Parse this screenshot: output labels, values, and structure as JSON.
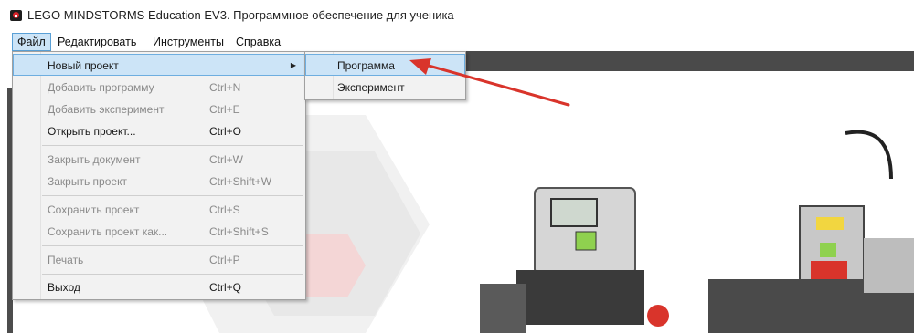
{
  "window": {
    "title": "LEGO MINDSTORMS Education EV3. Программное обеспечение для ученика"
  },
  "menubar": {
    "items": [
      {
        "label": "Файл"
      },
      {
        "label": "Редактировать"
      },
      {
        "label": "Инструменты"
      },
      {
        "label": "Справка"
      }
    ]
  },
  "file_menu": {
    "items": [
      {
        "label": "Новый проект",
        "shortcut": "",
        "submenu": true
      },
      {
        "label": "Добавить программу",
        "shortcut": "Ctrl+N",
        "disabled": true
      },
      {
        "label": "Добавить эксперимент",
        "shortcut": "Ctrl+E",
        "disabled": true
      },
      {
        "label": "Открыть проект...",
        "shortcut": "Ctrl+O"
      },
      {
        "label": "Закрыть документ",
        "shortcut": "Ctrl+W",
        "disabled": true
      },
      {
        "label": "Закрыть проект",
        "shortcut": "Ctrl+Shift+W",
        "disabled": true
      },
      {
        "label": "Сохранить проект",
        "shortcut": "Ctrl+S",
        "disabled": true
      },
      {
        "label": "Сохранить проект как...",
        "shortcut": "Ctrl+Shift+S",
        "disabled": true
      },
      {
        "label": "Печать",
        "shortcut": "Ctrl+P",
        "disabled": true
      },
      {
        "label": "Выход",
        "shortcut": "Ctrl+Q"
      }
    ]
  },
  "new_project_submenu": {
    "items": [
      {
        "label": "Программа"
      },
      {
        "label": "Эксперимент"
      }
    ]
  },
  "colors": {
    "highlight": "#cce4f7",
    "annotation_arrow": "#d9342b",
    "dark_toolbar": "#4a4a4a"
  },
  "icons": [
    "lego-mindstorms-app-icon",
    "submenu-arrow-icon",
    "annotation-arrow-icon"
  ]
}
